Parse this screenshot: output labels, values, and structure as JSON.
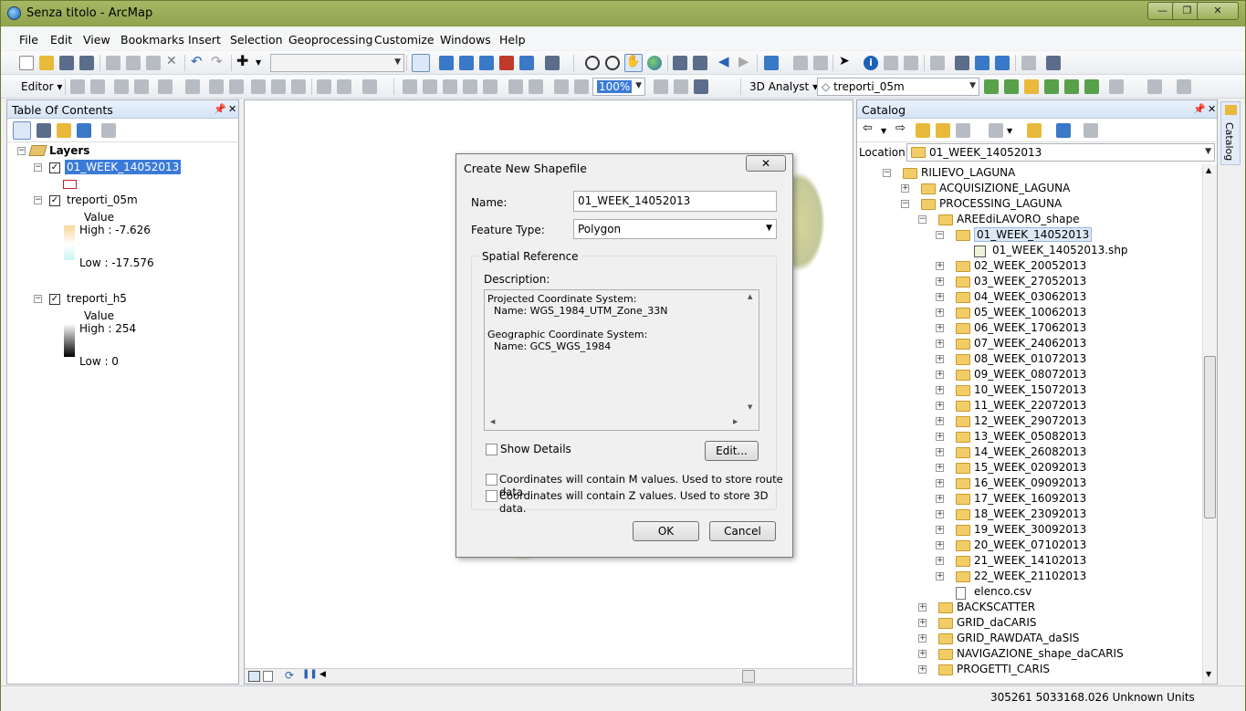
{
  "window": {
    "title": "Senza titolo - ArcMap",
    "minimize": "—",
    "maximize": "❐",
    "close": "✕"
  },
  "menu": [
    "File",
    "Edit",
    "View",
    "Bookmarks",
    "Insert",
    "Selection",
    "Geoprocessing",
    "Customize",
    "Windows",
    "Help"
  ],
  "toolbar": {
    "scale_value": "",
    "zoom_value": "100%",
    "editor_label": "Editor ▾",
    "analyst_label": "3D Analyst ▾",
    "layer_combo": "treporti_05m"
  },
  "toc": {
    "title": "Table Of Contents",
    "root": "Layers",
    "layers": [
      {
        "name": "01_WEEK_14052013"
      },
      {
        "name": "treporti_05m",
        "legend_title": "Value",
        "high": "High : -7.626",
        "low": "Low : -17.576"
      },
      {
        "name": "treporti_h5",
        "legend_title": "Value",
        "high": "High : 254",
        "low": "Low : 0"
      }
    ]
  },
  "catalog": {
    "title": "Catalog",
    "side_tab": "Catalog",
    "location_label": "Location:",
    "location_value": "01_WEEK_14052013",
    "items": [
      {
        "label": "RILIEVO_LAGUNA",
        "level": 0,
        "exp": "−",
        "type": "folder"
      },
      {
        "label": "ACQUISIZIONE_LAGUNA",
        "level": 1,
        "exp": "+",
        "type": "folder"
      },
      {
        "label": "PROCESSING_LAGUNA",
        "level": 1,
        "exp": "−",
        "type": "folder"
      },
      {
        "label": "AREEdiLAVORO_shape",
        "level": 2,
        "exp": "−",
        "type": "folder"
      },
      {
        "label": "01_WEEK_14052013",
        "level": 3,
        "exp": "−",
        "type": "folder",
        "selected": true
      },
      {
        "label": "01_WEEK_14052013.shp",
        "level": 4,
        "exp": "",
        "type": "shp"
      },
      {
        "label": "02_WEEK_20052013",
        "level": 3,
        "exp": "+",
        "type": "folder"
      },
      {
        "label": "03_WEEK_27052013",
        "level": 3,
        "exp": "+",
        "type": "folder"
      },
      {
        "label": "04_WEEK_03062013",
        "level": 3,
        "exp": "+",
        "type": "folder"
      },
      {
        "label": "05_WEEK_10062013",
        "level": 3,
        "exp": "+",
        "type": "folder"
      },
      {
        "label": "06_WEEK_17062013",
        "level": 3,
        "exp": "+",
        "type": "folder"
      },
      {
        "label": "07_WEEK_24062013",
        "level": 3,
        "exp": "+",
        "type": "folder"
      },
      {
        "label": "08_WEEK_01072013",
        "level": 3,
        "exp": "+",
        "type": "folder"
      },
      {
        "label": "09_WEEK_08072013",
        "level": 3,
        "exp": "+",
        "type": "folder"
      },
      {
        "label": "10_WEEK_15072013",
        "level": 3,
        "exp": "+",
        "type": "folder"
      },
      {
        "label": "11_WEEK_22072013",
        "level": 3,
        "exp": "+",
        "type": "folder"
      },
      {
        "label": "12_WEEK_29072013",
        "level": 3,
        "exp": "+",
        "type": "folder"
      },
      {
        "label": "13_WEEK_05082013",
        "level": 3,
        "exp": "+",
        "type": "folder"
      },
      {
        "label": "14_WEEK_26082013",
        "level": 3,
        "exp": "+",
        "type": "folder"
      },
      {
        "label": "15_WEEK_02092013",
        "level": 3,
        "exp": "+",
        "type": "folder"
      },
      {
        "label": "16_WEEK_09092013",
        "level": 3,
        "exp": "+",
        "type": "folder"
      },
      {
        "label": "17_WEEK_16092013",
        "level": 3,
        "exp": "+",
        "type": "folder"
      },
      {
        "label": "18_WEEK_23092013",
        "level": 3,
        "exp": "+",
        "type": "folder"
      },
      {
        "label": "19_WEEK_30092013",
        "level": 3,
        "exp": "+",
        "type": "folder"
      },
      {
        "label": "20_WEEK_07102013",
        "level": 3,
        "exp": "+",
        "type": "folder"
      },
      {
        "label": "21_WEEK_14102013",
        "level": 3,
        "exp": "+",
        "type": "folder"
      },
      {
        "label": "22_WEEK_21102013",
        "level": 3,
        "exp": "+",
        "type": "folder"
      },
      {
        "label": "elenco.csv",
        "level": 3,
        "exp": "",
        "type": "file"
      },
      {
        "label": "BACKSCATTER",
        "level": 2,
        "exp": "+",
        "type": "folder"
      },
      {
        "label": "GRID_daCARIS",
        "level": 2,
        "exp": "+",
        "type": "folder"
      },
      {
        "label": "GRID_RAWDATA_daSIS",
        "level": 2,
        "exp": "+",
        "type": "folder"
      },
      {
        "label": "NAVIGAZIONE_shape_daCARIS",
        "level": 2,
        "exp": "+",
        "type": "folder"
      },
      {
        "label": "PROGETTI_CARIS",
        "level": 2,
        "exp": "+",
        "type": "folder"
      }
    ]
  },
  "dialog": {
    "title": "Create New Shapefile",
    "close": "✕",
    "name_label": "Name:",
    "name_value": "01_WEEK_14052013",
    "feature_type_label": "Feature Type:",
    "feature_type_value": "Polygon",
    "spatial_ref_label": "Spatial Reference",
    "description_label": "Description:",
    "description_lines": [
      "Projected Coordinate System:",
      "  Name: WGS_1984_UTM_Zone_33N",
      "",
      "Geographic Coordinate System:",
      "  Name: GCS_WGS_1984"
    ],
    "show_details": "Show Details",
    "edit_button": "Edit...",
    "m_values": "Coordinates will contain M values. Used to store route data.",
    "z_values": "Coordinates will contain Z values. Used to store 3D data.",
    "ok": "OK",
    "cancel": "Cancel"
  },
  "status": {
    "coords": "305261  5033168.026 Unknown Units"
  }
}
